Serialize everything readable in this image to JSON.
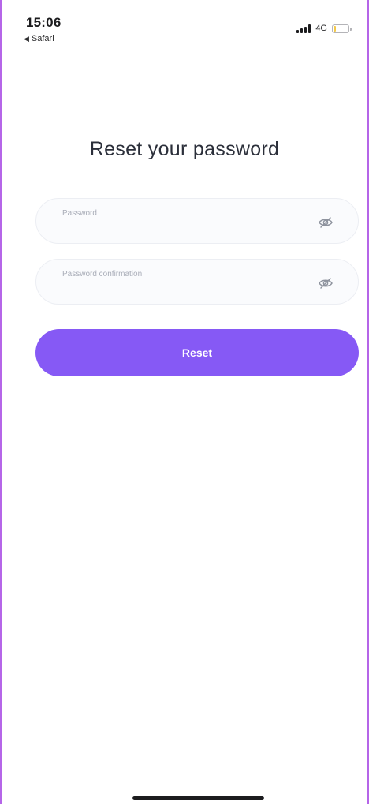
{
  "status_bar": {
    "time": "15:06",
    "back_app": "Safari",
    "network": "4G",
    "signal_icon": "signal-bars-icon",
    "battery_icon": "battery-low-icon",
    "battery_color": "#f3c94a"
  },
  "page": {
    "title": "Reset your password"
  },
  "form": {
    "password": {
      "label": "Password",
      "value": "",
      "toggle_icon": "eye-icon"
    },
    "password_confirmation": {
      "label": "Password confirmation",
      "value": "",
      "toggle_icon": "eye-icon"
    },
    "submit_label": "Reset"
  },
  "colors": {
    "accent": "#8659f5",
    "frame": "#b565e8"
  }
}
